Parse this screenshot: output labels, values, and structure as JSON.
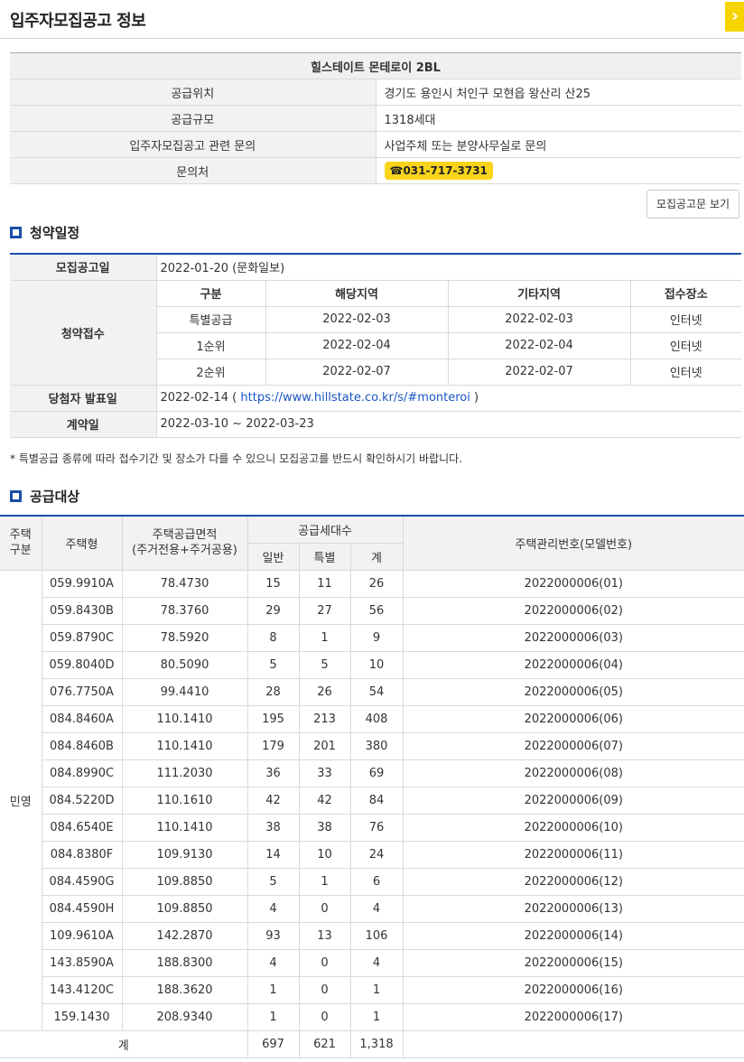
{
  "header": {
    "title": "입주자모집공고 정보",
    "close_icon": "chevron-right-icon"
  },
  "info": {
    "complex_name": "힐스테이트 몬테로이 2BL",
    "rows": [
      {
        "label": "공급위치",
        "value": "경기도 용인시 처인구 모현읍 왕산리 산25"
      },
      {
        "label": "공급규모",
        "value": "1318세대"
      },
      {
        "label": "입주자모집공고 관련 문의",
        "value": "사업주체 또는 분양사무실로 문의"
      }
    ],
    "contact_label": "문의처",
    "phone": "☎031-717-3731"
  },
  "notice_button": "모집공고문 보기",
  "schedule": {
    "title": "청약일정",
    "announce_label": "모집공고일",
    "announce_value": "2022-01-20 (문화일보)",
    "apply_label": "청약접수",
    "headers": [
      "구분",
      "해당지역",
      "기타지역",
      "접수장소"
    ],
    "rows": [
      [
        "특별공급",
        "2022-02-03",
        "2022-02-03",
        "인터넷"
      ],
      [
        "1순위",
        "2022-02-04",
        "2022-02-04",
        "인터넷"
      ],
      [
        "2순위",
        "2022-02-07",
        "2022-02-07",
        "인터넷"
      ]
    ],
    "winner_label": "당첨자 발표일",
    "winner_date": "2022-02-14 (",
    "winner_url": "https://www.hillstate.co.kr/s/#monteroi",
    "winner_close": ")",
    "contract_label": "계약일",
    "contract_value": "2022-03-10 ~ 2022-03-23"
  },
  "note": "* 특별공급 종류에 따라 접수기간 및 장소가 다를 수 있으니 모집공고를 반드시 확인하시기 바랍니다.",
  "supply": {
    "title": "공급대상",
    "headers": {
      "kind": "주택\n구분",
      "type": "주택형",
      "area": "주택공급면적\n(주거전용+주거공용)",
      "count": "공급세대수",
      "general": "일반",
      "special": "특별",
      "total": "계",
      "model": "주택관리번호(모델번호)"
    },
    "kind_value": "민영",
    "rows": [
      [
        "059.9910A",
        "78.4730",
        "15",
        "11",
        "26",
        "2022000006(01)"
      ],
      [
        "059.8430B",
        "78.3760",
        "29",
        "27",
        "56",
        "2022000006(02)"
      ],
      [
        "059.8790C",
        "78.5920",
        "8",
        "1",
        "9",
        "2022000006(03)"
      ],
      [
        "059.8040D",
        "80.5090",
        "5",
        "5",
        "10",
        "2022000006(04)"
      ],
      [
        "076.7750A",
        "99.4410",
        "28",
        "26",
        "54",
        "2022000006(05)"
      ],
      [
        "084.8460A",
        "110.1410",
        "195",
        "213",
        "408",
        "2022000006(06)"
      ],
      [
        "084.8460B",
        "110.1410",
        "179",
        "201",
        "380",
        "2022000006(07)"
      ],
      [
        "084.8990C",
        "111.2030",
        "36",
        "33",
        "69",
        "2022000006(08)"
      ],
      [
        "084.5220D",
        "110.1610",
        "42",
        "42",
        "84",
        "2022000006(09)"
      ],
      [
        "084.6540E",
        "110.1410",
        "38",
        "38",
        "76",
        "2022000006(10)"
      ],
      [
        "084.8380F",
        "109.9130",
        "14",
        "10",
        "24",
        "2022000006(11)"
      ],
      [
        "084.4590G",
        "109.8850",
        "5",
        "1",
        "6",
        "2022000006(12)"
      ],
      [
        "084.4590H",
        "109.8850",
        "4",
        "0",
        "4",
        "2022000006(13)"
      ],
      [
        "109.9610A",
        "142.2870",
        "93",
        "13",
        "106",
        "2022000006(14)"
      ],
      [
        "143.8590A",
        "188.8300",
        "4",
        "0",
        "4",
        "2022000006(15)"
      ],
      [
        "143.4120C",
        "188.3620",
        "1",
        "0",
        "1",
        "2022000006(16)"
      ],
      [
        "159.1430",
        "208.9340",
        "1",
        "0",
        "1",
        "2022000006(17)"
      ]
    ],
    "total_label": "계",
    "totals": [
      "697",
      "621",
      "1,318"
    ]
  }
}
